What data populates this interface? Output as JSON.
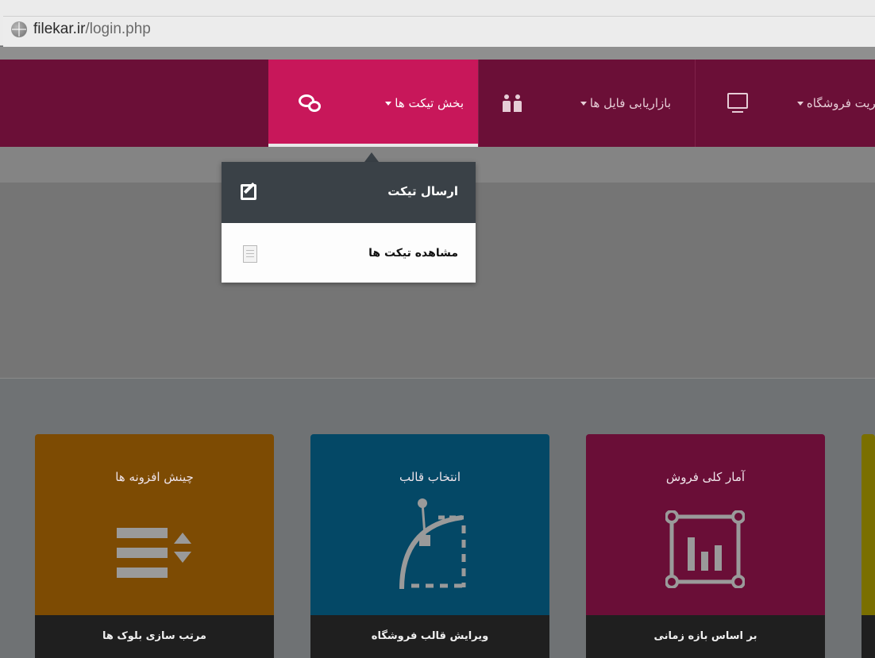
{
  "browser": {
    "url_host": "filekar.ir",
    "url_path": "/login.php"
  },
  "nav": {
    "items": [
      {
        "label": "بخش تیکت ها",
        "icon": "chat-bubbles-icon",
        "active": true
      },
      {
        "label": "بازاریابی فایل ها",
        "icon": "people-icon",
        "active": false
      },
      {
        "label": "یریت فروشگاه",
        "icon": "monitor-icon",
        "active": false
      }
    ]
  },
  "dropdown": {
    "items": [
      {
        "label": "ارسال تیکت",
        "icon": "edit-icon"
      },
      {
        "label": "مشاهده تیکت ها",
        "icon": "document-icon"
      }
    ]
  },
  "tiles": [
    {
      "title": "چینش افزونه ها",
      "footer": "مرتب سازی بلوک ها",
      "icon": "sort-icon",
      "color": "#7d4b03"
    },
    {
      "title": "انتخاب قالب",
      "footer": "ویرایش قالب فروشگاه",
      "icon": "bezier-curve-icon",
      "color": "#044866"
    },
    {
      "title": "آمار کلی فروش",
      "footer": "بر اساس بازه زمانی",
      "icon": "bar-chart-icon",
      "color": "#6a0e37"
    }
  ],
  "colors": {
    "nav_bg": "#6b0f37",
    "nav_active": "#c8175a",
    "dropdown_header": "#3a4147"
  }
}
